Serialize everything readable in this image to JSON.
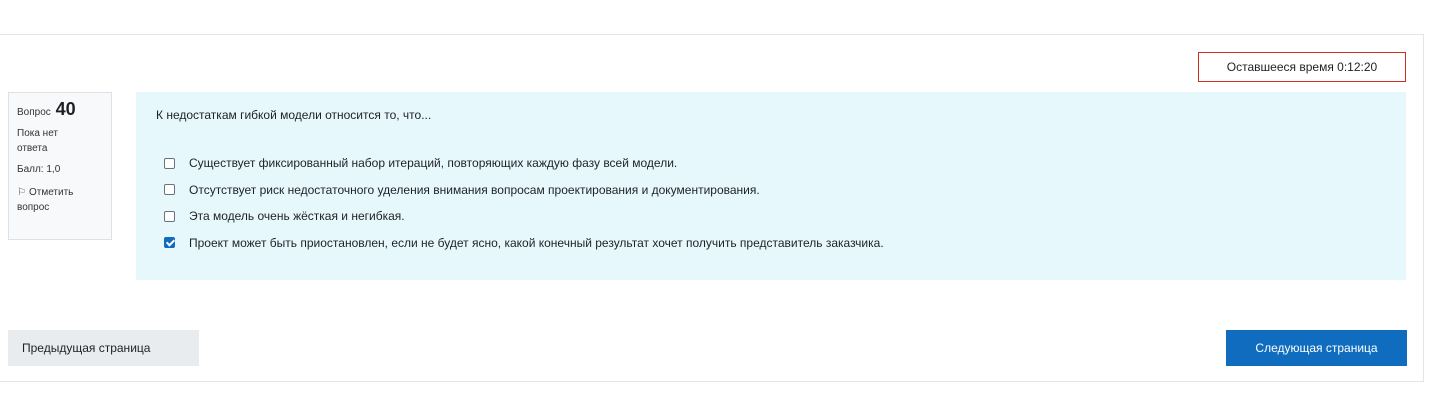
{
  "timer": {
    "label": "Оставшееся время 0:12:20"
  },
  "question_info": {
    "number_prefix": "Вопрос",
    "number": "40",
    "state": "Пока нет ответа",
    "grade": "Балл: 1,0",
    "flag_icon": "flag-icon",
    "flag_label": "Отметить вопрос"
  },
  "question": {
    "text": "К недостаткам гибкой модели относится то, что...",
    "answers": [
      {
        "label": "Существует фиксированный набор итераций, повторяющих каждую фазу всей модели.",
        "checked": false
      },
      {
        "label": "Отсутствует риск недостаточного уделения внимания вопросам проектирования и документирования.",
        "checked": false
      },
      {
        "label": "Эта модель очень жёсткая и негибкая.",
        "checked": false
      },
      {
        "label": "Проект может быть приостановлен, если не будет ясно, какой конечный результат хочет получить представитель заказчика.",
        "checked": true
      }
    ]
  },
  "navigation": {
    "prev_label": "Предыдущая страница",
    "next_label": "Следующая страница"
  },
  "colors": {
    "accent": "#0f6cbf",
    "question_bg": "#e7f8fd",
    "timer_border": "#ca3120"
  }
}
